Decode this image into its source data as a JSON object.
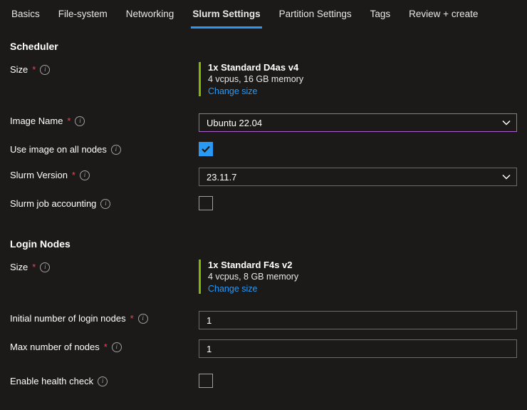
{
  "tabs": {
    "basics": "Basics",
    "filesystem": "File-system",
    "networking": "Networking",
    "slurm": "Slurm Settings",
    "partition": "Partition Settings",
    "tags": "Tags",
    "review": "Review + create"
  },
  "scheduler": {
    "title": "Scheduler",
    "size_label": "Size",
    "size_title": "1x Standard D4as v4",
    "size_sub": "4 vcpus, 16 GB memory",
    "size_link": "Change size",
    "image_label": "Image Name",
    "image_value": "Ubuntu 22.04",
    "use_image_label": "Use image on all nodes",
    "slurm_version_label": "Slurm Version",
    "slurm_version_value": "23.11.7",
    "job_accounting_label": "Slurm job accounting"
  },
  "login": {
    "title": "Login Nodes",
    "size_label": "Size",
    "size_title": "1x Standard F4s v2",
    "size_sub": "4 vcpus, 8 GB memory",
    "size_link": "Change size",
    "initial_label": "Initial number of login nodes",
    "initial_value": "1",
    "max_label": "Max number of nodes",
    "max_value": "1",
    "health_label": "Enable health check"
  }
}
